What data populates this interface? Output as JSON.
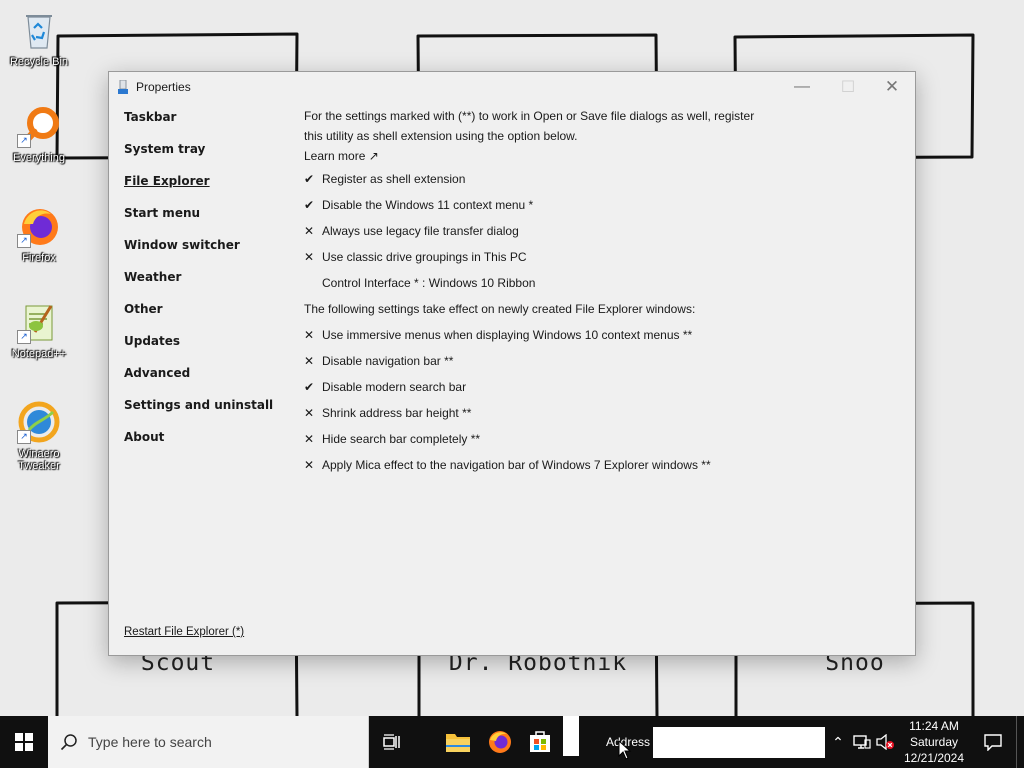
{
  "desktop": {
    "icons": [
      {
        "label": "Recycle Bin",
        "icon": "recycle-bin-icon"
      },
      {
        "label": "Everything",
        "icon": "everything-search-icon"
      },
      {
        "label": "Firefox",
        "icon": "firefox-icon"
      },
      {
        "label": "Notepad++",
        "icon": "notepad-plus-plus-icon"
      },
      {
        "label": "Winaero Tweaker",
        "icon": "winaero-tweaker-icon"
      }
    ],
    "wallpaper_labels": [
      "Scout",
      "Dr. Robotnik",
      "Snoo"
    ]
  },
  "window": {
    "title": "Properties",
    "sidebar": [
      {
        "label": "Taskbar",
        "active": false
      },
      {
        "label": "System tray",
        "active": false
      },
      {
        "label": "File Explorer",
        "active": true
      },
      {
        "label": "Start menu",
        "active": false
      },
      {
        "label": "Window switcher",
        "active": false
      },
      {
        "label": "Weather",
        "active": false
      },
      {
        "label": "Other",
        "active": false
      },
      {
        "label": "Updates",
        "active": false
      },
      {
        "label": "Advanced",
        "active": false
      },
      {
        "label": "Settings and uninstall",
        "active": false
      },
      {
        "label": "About",
        "active": false
      }
    ],
    "restart_link": "Restart File Explorer (*)",
    "intro_line1": "For the settings marked with (**) to work in Open or Save file dialogs as well, register",
    "intro_line2": "this utility as shell extension using the option below.",
    "learn_more": "Learn more ↗",
    "settings_top": [
      {
        "label": "Register as shell extension",
        "checked": true
      },
      {
        "label": "Disable the Windows 11 context menu *",
        "checked": true
      },
      {
        "label": "Always use legacy file transfer dialog",
        "checked": false
      },
      {
        "label": "Use classic drive groupings in This PC",
        "checked": false
      }
    ],
    "control_interface": "Control Interface * : Windows 10 Ribbon",
    "section_text": "The following settings take effect on newly created File Explorer windows:",
    "settings_bottom": [
      {
        "label": "Use immersive menus when displaying Windows 10 context menus **",
        "checked": false
      },
      {
        "label": "Disable navigation bar **",
        "checked": false
      },
      {
        "label": "Disable modern search bar",
        "checked": true
      },
      {
        "label": "Shrink address bar height **",
        "checked": false
      },
      {
        "label": "Hide search bar completely **",
        "checked": false
      },
      {
        "label": "Apply Mica effect to the navigation bar of Windows 7 Explorer windows **",
        "checked": false
      }
    ],
    "marks": {
      "checked": "✔",
      "unchecked": "✕"
    }
  },
  "taskbar": {
    "search_placeholder": "Type here to search",
    "address_label": "Address",
    "address_value": "",
    "clock": {
      "time": "11:24 AM",
      "day": "Saturday",
      "date": "12/21/2024"
    }
  },
  "colors": {
    "taskbar": "#101010",
    "window_bg": "#f0f0f0",
    "desktop_bg": "#ebebeb"
  }
}
